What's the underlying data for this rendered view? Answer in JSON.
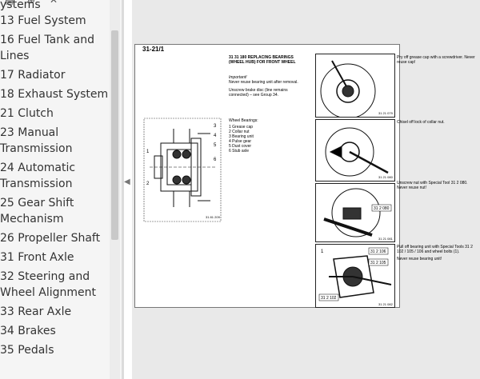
{
  "toc": {
    "partial_top": "ystems",
    "items": [
      {
        "num": "13",
        "title": "Fuel System"
      },
      {
        "num": "16",
        "title": "Fuel Tank and",
        "cont": "Lines"
      },
      {
        "num": "17",
        "title": "Radiator"
      },
      {
        "num": "18",
        "title": "Exhaust System"
      },
      {
        "num": "21",
        "title": "Clutch"
      },
      {
        "num": "23",
        "title": "Manual",
        "cont": "Transmission"
      },
      {
        "num": "24",
        "title": "Automatic",
        "cont": "Transmission"
      },
      {
        "num": "25",
        "title": "Gear Shift",
        "cont": "Mechanism"
      },
      {
        "num": "26",
        "title": "Propeller Shaft"
      },
      {
        "num": "31",
        "title": "Front Axle"
      },
      {
        "num": "32",
        "title": "Steering and",
        "cont": "Wheel Alignment"
      },
      {
        "num": "33",
        "title": "Rear Axle"
      },
      {
        "num": "34",
        "title": "Brakes"
      },
      {
        "num": "35",
        "title": "Pedals"
      }
    ]
  },
  "toolbar": {
    "icons": [
      "bookmark-list-icon",
      "add-bookmark-icon",
      "bookmark-icon"
    ]
  },
  "document": {
    "page_ref": "31-21/1",
    "op_code": "31 31 180",
    "op_title": "REPLACING BEARINGS (WHEEL HUB) FOR FRONT WHEEL",
    "important_label": "Important!",
    "important_text": "Never reuse bearing unit after removal.",
    "brake_note": "Unscrew brake disc (line remains connected) – see Group 34.",
    "wheel_bearings_title": "Wheel Bearings:",
    "legend": [
      "1  Grease cap",
      "2  Collar nut",
      "3  Bearing unit",
      "4  Pulse gear",
      "5  Dust cover",
      "6  Stub axle"
    ],
    "fig_code_main": "31 81 209",
    "steps": [
      {
        "text": "Pry off grease cap with a screwdriver. Never reuse cap!",
        "code": "31 21 079"
      },
      {
        "text": "Chisel off lock of collar nut.",
        "code": "31 21 080"
      },
      {
        "text": "Unscrew nut with Special Tool 31 2 080. Never reuse nut!",
        "label": "31 2 080",
        "code": "31 21 081"
      },
      {
        "text": "Pull off bearing unit with Special Tools 31 2 102 / 105 / 106 and wheel bolts (1).",
        "text2": "Never reuse bearing unit!",
        "label_a": "31 2 106",
        "label_b": "31 2 105",
        "label_c": "31 2 102",
        "label_num": "1",
        "code": "31 21 082"
      }
    ],
    "diagram_labels": [
      "1",
      "2",
      "3",
      "4",
      "5",
      "6"
    ]
  }
}
